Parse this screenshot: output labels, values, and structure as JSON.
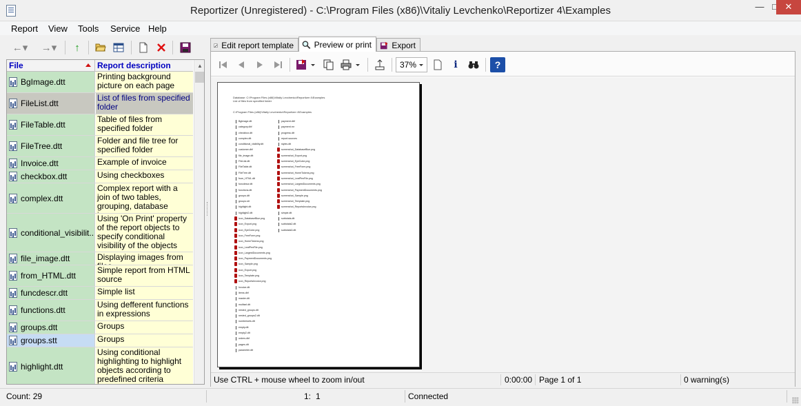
{
  "window": {
    "title": "Reportizer (Unregistered) - C:\\Program Files (x86)\\Vitaliy Levchenko\\Reportizer 4\\Examples",
    "minimize": "—",
    "maximize": "□",
    "close": "✕"
  },
  "menu": [
    "Report",
    "View",
    "Tools",
    "Service",
    "Help"
  ],
  "left_toolbar": {
    "back_glyph": "←▾",
    "forward_glyph": "→▾",
    "up_glyph": "↑"
  },
  "filelist": {
    "col_file": "File",
    "col_desc": "Report description",
    "rows": [
      {
        "file": "BgImage.dtt",
        "desc": "Printing background picture on each page"
      },
      {
        "file": "FileList.dtt",
        "desc": "List of files from specified folder"
      },
      {
        "file": "FileTable.dtt",
        "desc": "Table of files from specified folder"
      },
      {
        "file": "FileTree.dtt",
        "desc": "Folder and file tree for specified folder"
      },
      {
        "file": "Invoice.dtt",
        "desc": "Example of invoice"
      },
      {
        "file": "checkbox.dtt",
        "desc": "Using checkboxes"
      },
      {
        "file": "complex.dtt",
        "desc": "Complex report with a join of two tables, grouping, database images"
      },
      {
        "file": "conditional_visibilit...",
        "desc": "Using 'On Print' property of the report objects to specify conditional visibility of the objects"
      },
      {
        "file": "file_image.dtt",
        "desc": "Displaying images from files"
      },
      {
        "file": "from_HTML.dtt",
        "desc": "Simple report from HTML source"
      },
      {
        "file": "funcdescr.dtt",
        "desc": "Simple list"
      },
      {
        "file": "functions.dtt",
        "desc": "Using defferent functions in expressions"
      },
      {
        "file": "groups.dtt",
        "desc": "Groups"
      },
      {
        "file": "groups.stt",
        "desc": "Groups"
      },
      {
        "file": "highlight.dtt",
        "desc": "Using conditional highlighting to highlight objects according to predefined criteria"
      }
    ]
  },
  "tabs": [
    "Edit report template",
    "Preview or print",
    "Export"
  ],
  "preview_toolbar": {
    "zoom": "37%",
    "info_glyph": "i",
    "help_glyph": "?"
  },
  "preview_page": {
    "header_line1": "Database: C:\\Program Files (x86)\\Vitaliy Levchenko\\Reportizer 4\\Examples",
    "header_line2": "List of files from specified folder",
    "path": "C:\\Program Files (x86)\\Vitaliy Levchenko\\Reportizer 4\\Examples",
    "col1": [
      "BgImage.dtt",
      "category.dbf",
      "checkbox.dtt",
      "complex.dtt",
      "conditional_visibility.dtt",
      "customer.dbf",
      "file_image.dtt",
      "FileList.dtt",
      "FileTable.dtt",
      "FileTree.dtt",
      "from_HTML.dtt",
      "funcdescr.dtt",
      "functions.dtt",
      "groups.dtt",
      "groups.stt",
      "highlight.dtt",
      "highlight2.dtt",
      "icon_DatabaseBlue.png",
      "icon_Export.png",
      "icon_EyeCube.png",
      "icon_FreeForm.png",
      "icon_HomeTokens.png",
      "icon_LeafPenFile.png",
      "icon_LargestDocuments.png",
      "icon_PaymentDocuments.png",
      "icon_Sample.png",
      "icon_Export.png",
      "icon_Template.png",
      "icon_ReportsInvoice.png",
      "Invoice.dtt",
      "items.dbf",
      "master.dtt",
      "multisel.dtt",
      "nested_groups.dtt",
      "nested_groups2.dtt",
      "numbersets.dtt",
      "empty.dtt",
      "empty2.dtt",
      "orders.dbf",
      "pages.dtt",
      "parameter.dtt"
    ],
    "col1_red": [
      17,
      18,
      19,
      20,
      21,
      22,
      23,
      24,
      25,
      26,
      27,
      28
    ],
    "col2": [
      "payment.dbf",
      "payment.mr",
      "progress.dtt",
      "report.sources",
      "styles.dtt",
      "screenshot_DatabaseBlue.png",
      "screenshot_Export.png",
      "screenshot_EyeCube.png",
      "screenshot_FreeForm.png",
      "screenshot_HomeTokens.png",
      "screenshot_LeafPenFile.png",
      "screenshot_LargestDocuments.png",
      "screenshot_PaymentDocuments.png",
      "screenshot_Sample.png",
      "screenshot_Template.png",
      "screenshot_ReportsInvoice.png",
      "simple.dtt",
      "subtotals.dtt",
      "subtotals2.dtt",
      "subtotals3.dtt"
    ],
    "col2_red": [
      5,
      6,
      7,
      8,
      9,
      10,
      11,
      12,
      13,
      14,
      15
    ]
  },
  "preview_status": {
    "hint": "Use CTRL + mouse wheel to zoom in/out",
    "time": "0:00:00",
    "page": "Page 1 of 1",
    "warnings": "0 warning(s)"
  },
  "statusbar": {
    "count": "Count: 29",
    "pos_line": "1:",
    "pos_col": "1",
    "connection": "Connected"
  }
}
